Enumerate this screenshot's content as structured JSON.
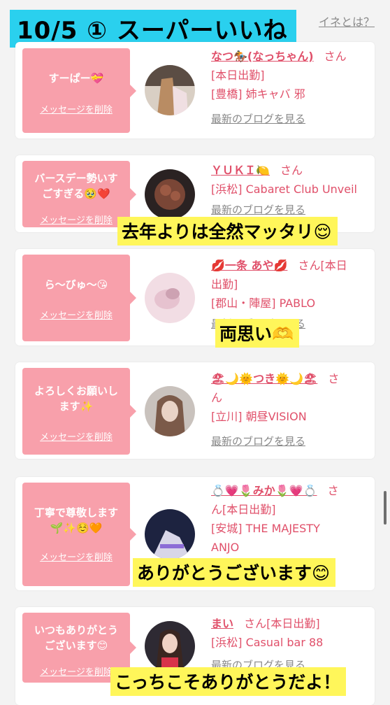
{
  "top_link": "イネとは？",
  "title": "10/5 ① スーパーいいね",
  "delete_label": "メッセージを削除",
  "blog_label": "最新のブログを見る",
  "cards": [
    {
      "message": [
        "すーぱー💝"
      ],
      "name": "なつ🏇(なっちゃん)",
      "san": "さん",
      "lines": [
        "[本日出勤]",
        "[豊橋] 姉キャバ 邪"
      ]
    },
    {
      "message": [
        "バースデー勢いす",
        "ごすぎる🥹❤️"
      ],
      "name": "ＹＵＫＩ🍋",
      "san": "さん",
      "lines": [
        "[浜松] Cabaret Club Unveil"
      ]
    },
    {
      "message": [
        "ら〜びゅ〜😘"
      ],
      "name": "💋一条 あや💋",
      "san": "さん[本日",
      "lines": [
        "出勤]",
        "[郡山・陣屋] PABLO"
      ]
    },
    {
      "message": [
        "よろしくお願いし",
        "ます✨"
      ],
      "name": "🏖🌙🌞つき🌞🌙🏖",
      "san": "さ",
      "lines": [
        "ん",
        "[立川] 朝昼VISION"
      ]
    },
    {
      "message": [
        "丁寧で尊敬します",
        "🌱✨☺️🧡"
      ],
      "name": "💍💗🌷みか🌷💗💍",
      "san": "さ",
      "lines": [
        "ん[本日出勤]",
        "[安城] THE MAJESTY",
        "ANJO"
      ]
    },
    {
      "message": [
        "いつもありがとう",
        "ございます😊"
      ],
      "name": "まい",
      "san": "さん[本日出勤]",
      "lines": [
        "[浜松] Casual bar 88"
      ]
    }
  ],
  "captions": {
    "c1": "去年よりは全然マッタリ😌",
    "c2": "両思い🫶",
    "c3": "ありがとうございます😊",
    "c4": "こっちこそありがとうだよ！"
  }
}
